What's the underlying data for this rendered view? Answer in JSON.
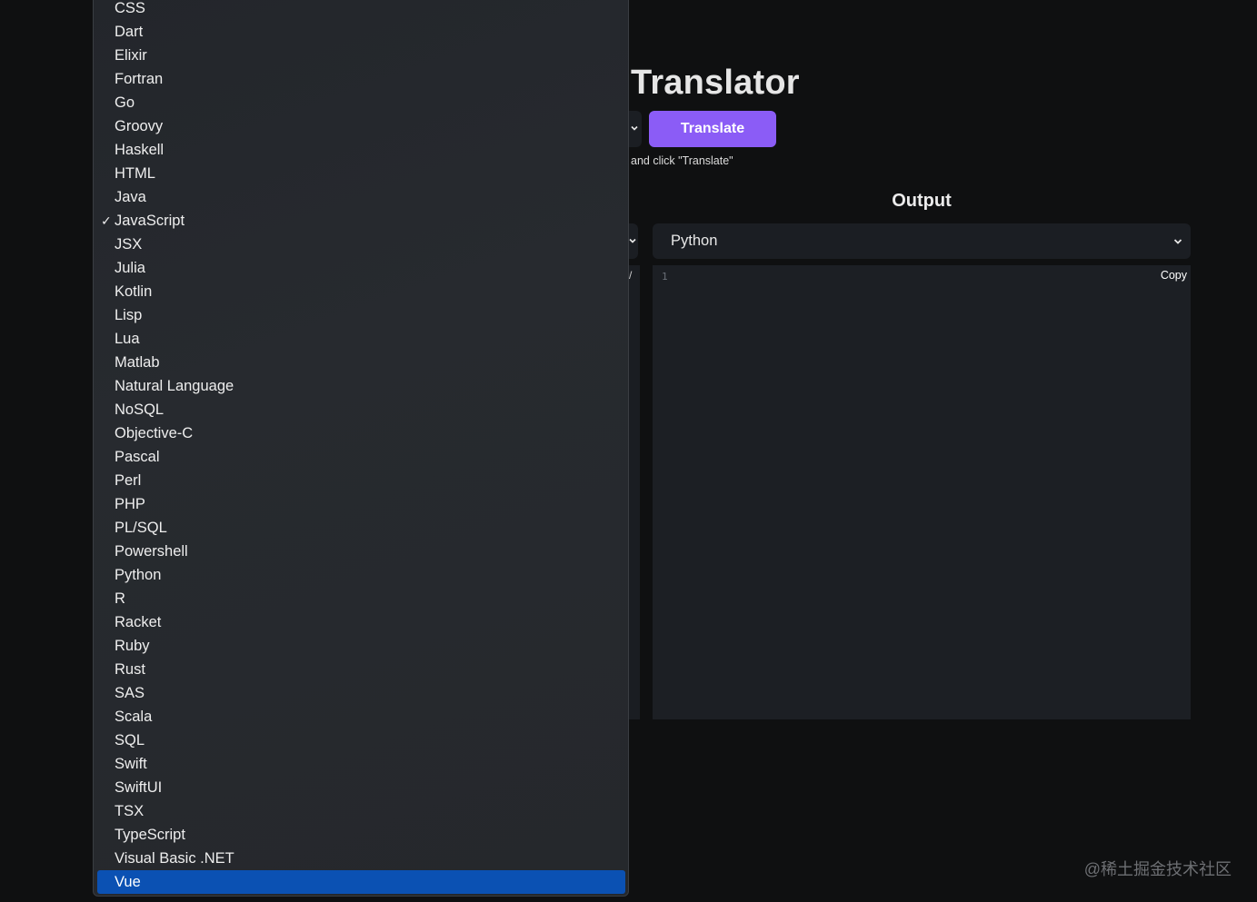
{
  "app": {
    "title": "Translator",
    "translate_label": "Translate",
    "hint": "and click \"Translate\""
  },
  "output": {
    "label": "Output",
    "selected_language": "Python",
    "line_number": "1",
    "copy_label": "Copy"
  },
  "left_panel_fragments": {
    "editor_glyph": "/"
  },
  "dropdown": {
    "checked": "JavaScript",
    "highlighted": "Vue",
    "items": [
      "CSS",
      "Dart",
      "Elixir",
      "Fortran",
      "Go",
      "Groovy",
      "Haskell",
      "HTML",
      "Java",
      "JavaScript",
      "JSX",
      "Julia",
      "Kotlin",
      "Lisp",
      "Lua",
      "Matlab",
      "Natural Language",
      "NoSQL",
      "Objective-C",
      "Pascal",
      "Perl",
      "PHP",
      "PL/SQL",
      "Powershell",
      "Python",
      "R",
      "Racket",
      "Ruby",
      "Rust",
      "SAS",
      "Scala",
      "SQL",
      "Swift",
      "SwiftUI",
      "TSX",
      "TypeScript",
      "Visual Basic .NET",
      "Vue"
    ]
  },
  "watermark": "@稀土掘金技术社区",
  "colors": {
    "accent": "#8b5cf6",
    "highlight": "#0b51b3",
    "background": "#0f1011",
    "panel": "#1c1f24"
  }
}
